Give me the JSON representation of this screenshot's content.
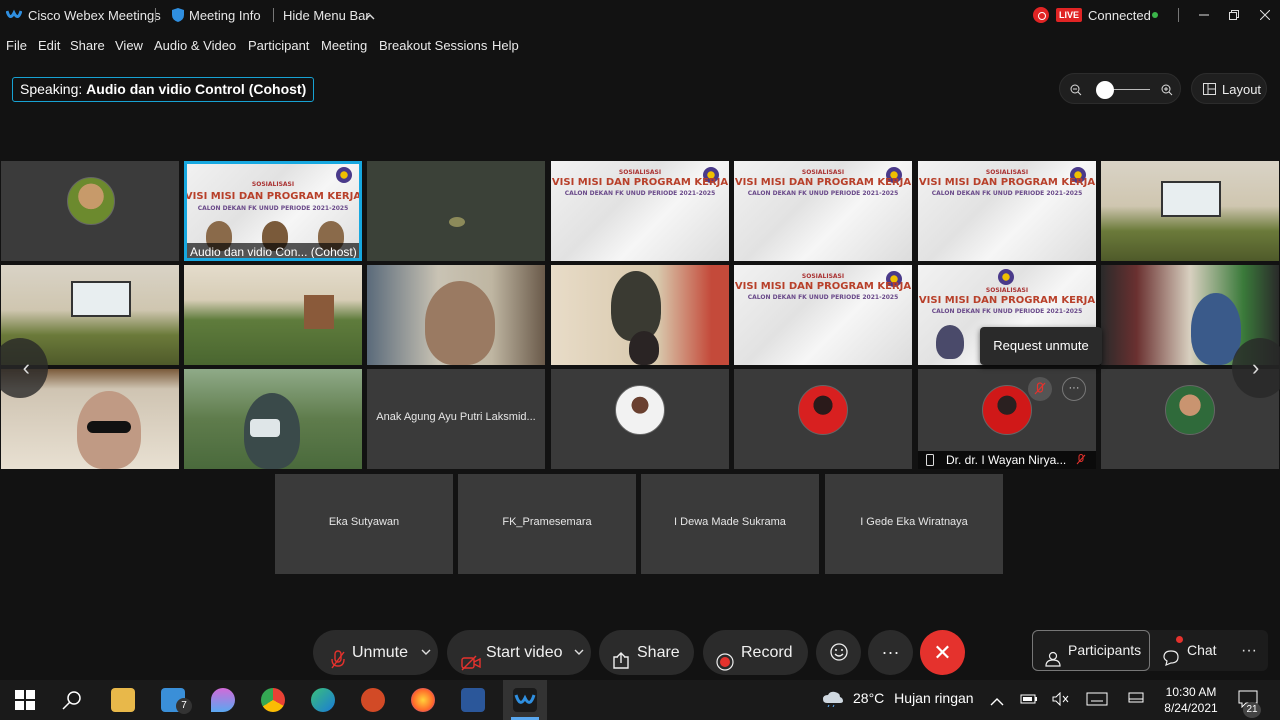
{
  "titlebar": {
    "app_name": "Cisco Webex Meetings",
    "meeting_info": "Meeting Info",
    "hide_menu": "Hide Menu Bar",
    "live_badge": "LIVE",
    "status": "Connected"
  },
  "menu": [
    "File",
    "Edit",
    "Share",
    "View",
    "Audio & Video",
    "Participant",
    "Meeting",
    "Breakout Sessions",
    "Help"
  ],
  "speaking": {
    "prefix": "Speaking:",
    "name": "Audio dan vidio Control (Cohost)"
  },
  "layout_label": "Layout",
  "zoom_level": 0.1,
  "slide_text": {
    "top": "SOSIALISASI",
    "main": "VISI MISI DAN PROGRAM KERJA",
    "sub": "CALON DEKAN FK UNUD PERIODE 2021-2025"
  },
  "tiles": {
    "cohost_label": "Audio dan vidio Con... (Cohost)",
    "anak_agung": "Anak Agung Ayu Putri Laksmid...",
    "wayan": "Dr. dr. I Wayan Nirya...",
    "eka": "Eka Sutyawan",
    "pramesemara": "FK_Pramesemara",
    "dewa": "I Dewa Made Sukrama",
    "gede": "I Gede Eka Wiratnaya"
  },
  "tooltip": "Request unmute",
  "controls": {
    "unmute": "Unmute",
    "start_video": "Start video",
    "share": "Share",
    "record": "Record",
    "participants": "Participants",
    "chat": "Chat"
  },
  "taskbar": {
    "mail_badge": "7",
    "temperature": "28°C",
    "weather": "Hujan ringan",
    "time": "10:30 AM",
    "date": "8/24/2021",
    "notif_count": "21"
  },
  "colors": {
    "accent": "#17a8e0",
    "end": "#e5322d",
    "live": "#e02424",
    "connected": "#3bb54a"
  }
}
